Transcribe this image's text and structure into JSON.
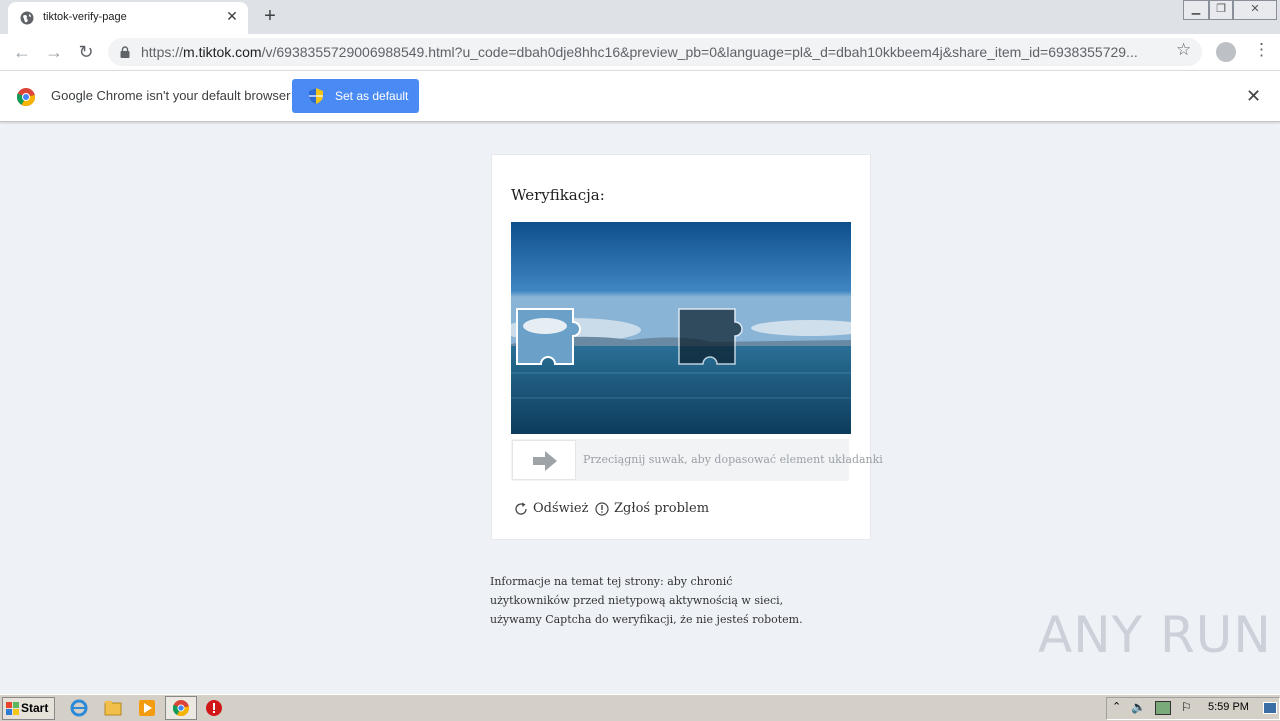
{
  "browser": {
    "tab_title": "tiktok-verify-page",
    "url_scheme": "https://",
    "url_host": "m.tiktok.com",
    "url_rest": "/v/6938355729006988549.html?u_code=dbah0dje8hhc16&preview_pb=0&language=pl&_d=dbah10kkbeem4j&share_item_id=6938355729..."
  },
  "infobar": {
    "message": "Google Chrome isn't your default browser",
    "button_label": "Set as default"
  },
  "captcha": {
    "title": "Weryfikacja:",
    "slider_hint": "Przeciągnij suwak, aby dopasować element układanki",
    "refresh_label": "Odśwież",
    "report_label": "Zgłoś problem"
  },
  "info": {
    "text": "Informacje na temat tej strony: aby chronić użytkowników przed nietypową aktywnością w sieci, używamy Captcha do weryfikacji, że nie jesteś robotem."
  },
  "watermark": "ANY RUN",
  "taskbar": {
    "start_label": "Start",
    "clock": "5:59 PM"
  },
  "colors": {
    "accent": "#4a8af4",
    "page_bg": "#eef1f6"
  }
}
